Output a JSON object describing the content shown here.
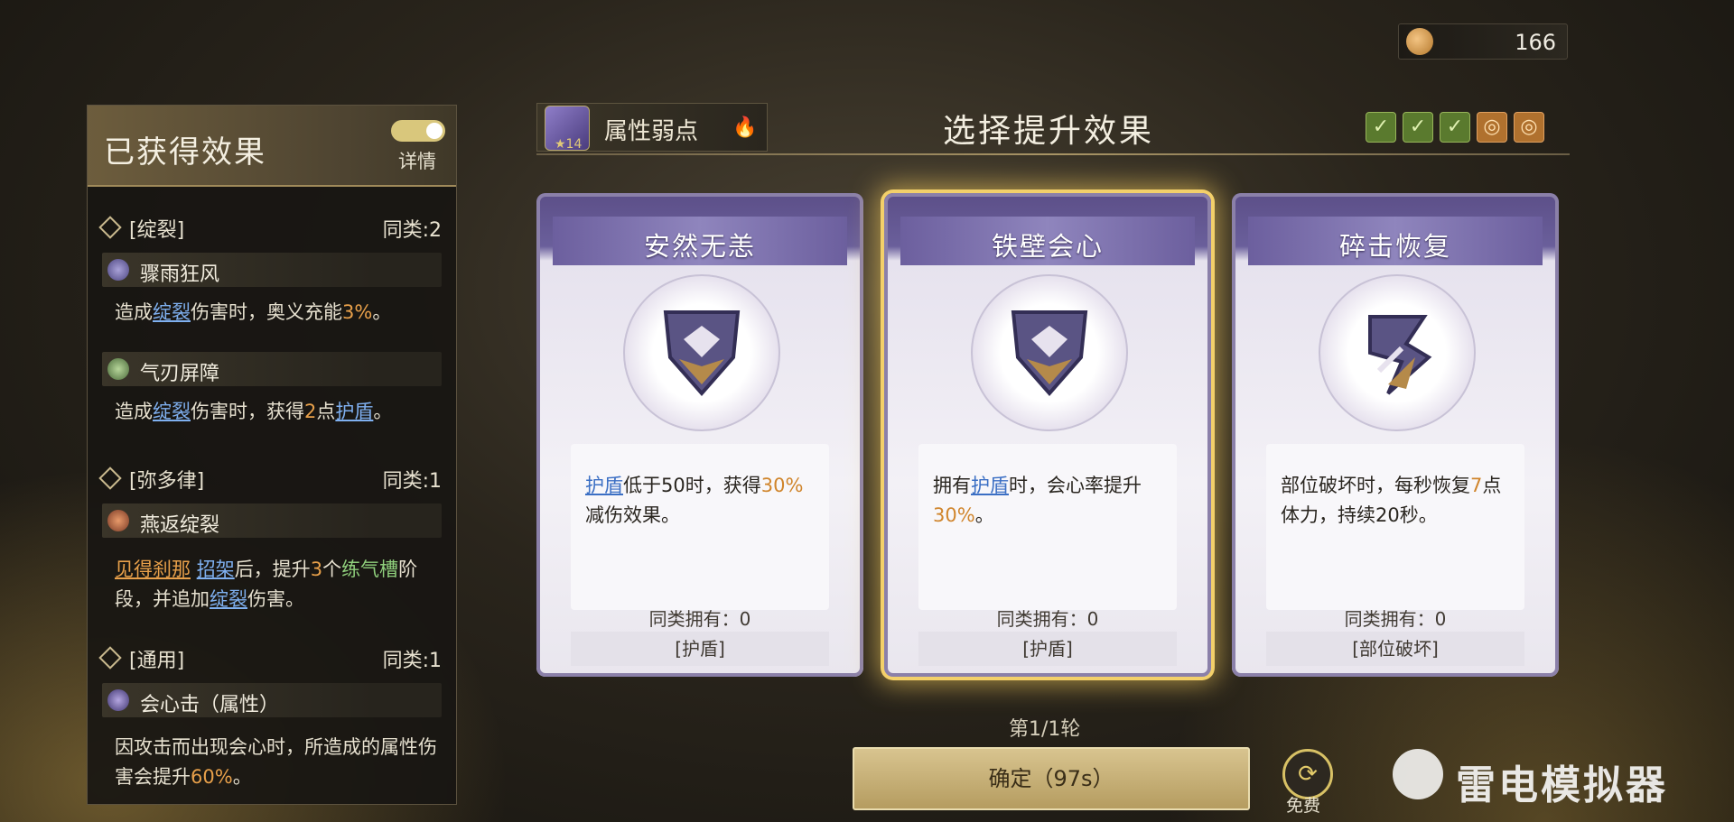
{
  "currency": {
    "value": "166",
    "icon": "peach-coin-icon"
  },
  "panel": {
    "title": "已获得效果",
    "details_label": "详情",
    "groups": [
      {
        "category": "[绽裂]",
        "count": "同类:2",
        "effects": [
          {
            "name": "骤雨狂风",
            "desc_parts": [
              "造成",
              "绽裂",
              "伤害时，奥义充能",
              "3%",
              "。"
            ]
          },
          {
            "name": "气刃屏障",
            "desc_parts": [
              "造成",
              "绽裂",
              "伤害时，获得",
              "2",
              "点",
              "护盾",
              "。"
            ]
          }
        ]
      },
      {
        "category": "[弥多律]",
        "count": "同类:1",
        "effects": [
          {
            "name": "燕返绽裂",
            "desc_parts": [
              "见得刹那",
              "招架",
              "后，提升",
              "3",
              "个",
              "练气槽",
              "阶段，并追加",
              "绽裂",
              "伤害。"
            ]
          }
        ]
      },
      {
        "category": "[通用]",
        "count": "同类:1",
        "effects": [
          {
            "name": "会心击（属性）",
            "desc_parts": [
              "因攻击而出现会心时，所造成的属性伤害会提升",
              "60%",
              "。"
            ]
          }
        ]
      }
    ]
  },
  "header": {
    "weakness_label": "属性弱点",
    "weakness_stars": "★14",
    "title": "选择提升效果",
    "progress_marks": [
      "done",
      "done",
      "done",
      "pending",
      "pending"
    ]
  },
  "cards": [
    {
      "title": "安然无恙",
      "text_parts": [
        "护盾",
        "低于50时，获得",
        "30%",
        "减伤效果。"
      ],
      "owned": "同类拥有：0",
      "tag": "[护盾]",
      "selected": false
    },
    {
      "title": "铁壁会心",
      "text_parts": [
        "拥有",
        "护盾",
        "时，会心率提升",
        "30%",
        "。"
      ],
      "owned": "同类拥有：0",
      "tag": "[护盾]",
      "selected": true
    },
    {
      "title": "碎击恢复",
      "text_parts": [
        "部位破坏时，每秒恢复",
        "7",
        "点体力，持续20秒。"
      ],
      "owned": "同类拥有：0",
      "tag": "[部位破坏]",
      "selected": false
    }
  ],
  "round": "第1/1轮",
  "confirm_label": "确定（97s）",
  "free_label": "免费",
  "watermark": "雷电模拟器",
  "colors": {
    "accent_gold": "#f3d06a",
    "keyword_blue": "#7fb0f0",
    "keyword_orange": "#e8a04a",
    "keyword_green": "#8fcf7c",
    "card_purple": "#6c5f9e"
  }
}
